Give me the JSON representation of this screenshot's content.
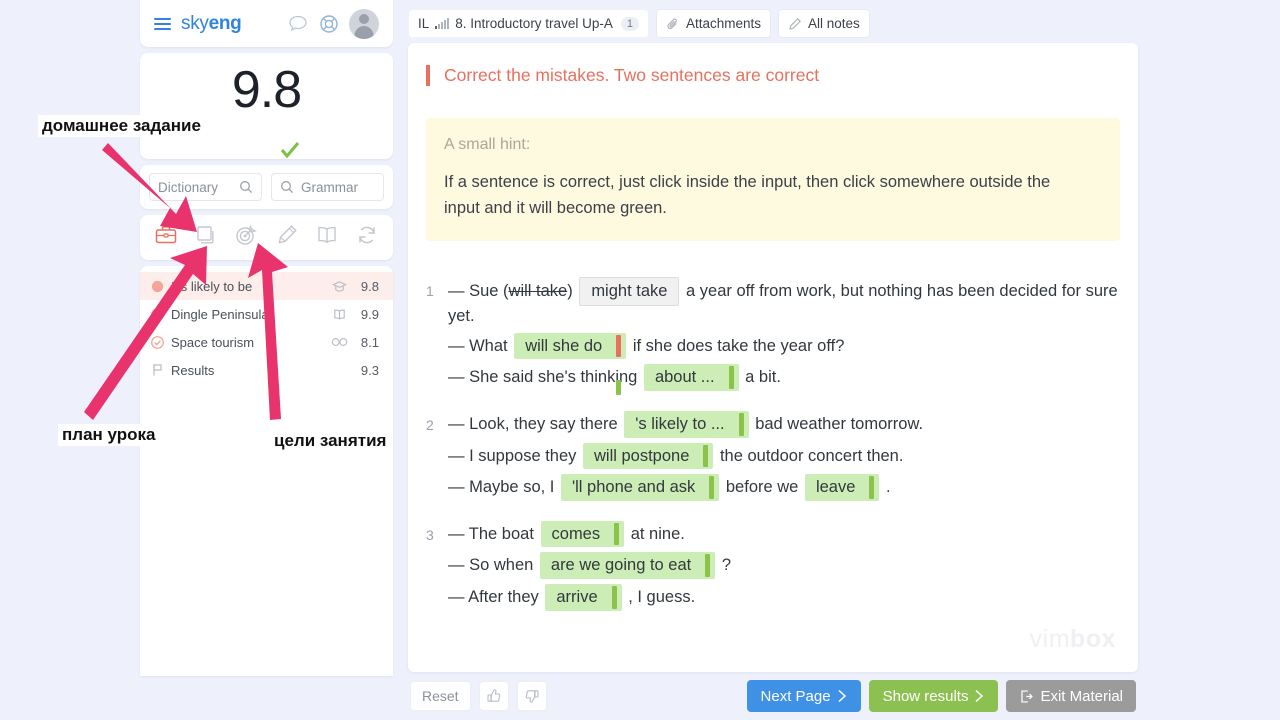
{
  "colors": {
    "page_bg": "#eef1fb",
    "brand_blue": "#2f84e0",
    "task_red": "#e8705f",
    "input_green": "#cdedb6",
    "accent_green": "#8bc34a",
    "next_blue": "#3e91e5",
    "results_green": "#8cc152",
    "exit_grey": "#9b9b9b",
    "annotation_pink": "#e8336d",
    "active_row": "#fdeeec",
    "hint_yellow": "#fdfae0"
  },
  "sidebar": {
    "logo": {
      "light": "sky",
      "bold": "eng"
    },
    "header_icons": [
      {
        "name": "chat-icon",
        "glyph": "chat-bubble"
      },
      {
        "name": "help-icon",
        "glyph": "lifebuoy"
      },
      {
        "name": "avatar",
        "glyph": "user-photo"
      }
    ],
    "score": "9.8",
    "search_dictionary": {
      "value": "",
      "placeholder": "Dictionary"
    },
    "search_grammar": {
      "value": "",
      "placeholder": "Grammar"
    },
    "tools": [
      {
        "name": "homework-icon",
        "label": "briefcase",
        "active": true
      },
      {
        "name": "cards-icon",
        "label": "copy",
        "active": false
      },
      {
        "name": "goals-icon",
        "label": "target",
        "active": false
      },
      {
        "name": "notes-icon",
        "label": "pencil",
        "active": false
      },
      {
        "name": "book-icon",
        "label": "book",
        "active": false
      },
      {
        "name": "refresh-icon",
        "label": "refresh",
        "active": false
      }
    ],
    "items": [
      {
        "label": "It's likely to be",
        "score": "9.8",
        "icon": "graduation-cap-icon",
        "status": "current",
        "active": true
      },
      {
        "label": "Dingle Peninsula",
        "score": "9.9",
        "icon": "open-book-icon",
        "status": "done",
        "active": false
      },
      {
        "label": "Space tourism",
        "score": "8.1",
        "icon": "glasses-icon",
        "status": "done",
        "active": false
      },
      {
        "label": "Results",
        "score": "9.3",
        "icon": "",
        "status": "flag",
        "active": false
      }
    ]
  },
  "topbar": {
    "lesson_prefix": "IL",
    "lesson_title": "8. Introductory travel Up-A",
    "lesson_badge": "1",
    "attachments_label": "Attachments",
    "all_notes_label": "All notes"
  },
  "main": {
    "task_title": "Correct the mistakes. Two sentences are correct",
    "hint_label": "A small hint:",
    "hint_text": "If a sentence is correct, just click inside the input, then click somewhere outside the input and it will become green.",
    "watermark": {
      "light": "vim",
      "bold": "box"
    },
    "exercises": [
      {
        "number": "1",
        "lines": [
          [
            {
              "t": "text",
              "v": "— Sue ("
            },
            {
              "t": "strike",
              "v": "will take"
            },
            {
              "t": "text",
              "v": ") "
            },
            {
              "t": "input-grey",
              "v": "might take"
            },
            {
              "t": "text",
              "v": " a year off from work, but nothing has been decided for sure yet."
            }
          ],
          [
            {
              "t": "text",
              "v": "— What "
            },
            {
              "t": "input-green-active",
              "v": "will she do"
            },
            {
              "t": "text",
              "v": " if she does take the year off?"
            }
          ],
          [
            {
              "t": "text",
              "v": "— She said she's thinking "
            },
            {
              "t": "input-green",
              "v": "about ..."
            },
            {
              "t": "text",
              "v": " a bit."
            }
          ]
        ]
      },
      {
        "number": "2",
        "lines": [
          [
            {
              "t": "text",
              "v": "— Look, they say there "
            },
            {
              "t": "input-green",
              "v": "'s likely to ..."
            },
            {
              "t": "text",
              "v": " bad weather tomorrow."
            }
          ],
          [
            {
              "t": "text",
              "v": "— I suppose they "
            },
            {
              "t": "input-green",
              "v": "will postpone"
            },
            {
              "t": "text",
              "v": " the outdoor concert then."
            }
          ],
          [
            {
              "t": "text",
              "v": "— Maybe so, I "
            },
            {
              "t": "input-green",
              "v": "'ll phone and ask"
            },
            {
              "t": "text",
              "v": " before we "
            },
            {
              "t": "input-green",
              "v": "leave"
            },
            {
              "t": "text",
              "v": " ."
            }
          ]
        ]
      },
      {
        "number": "3",
        "lines": [
          [
            {
              "t": "text",
              "v": "— The boat "
            },
            {
              "t": "input-green",
              "v": "comes"
            },
            {
              "t": "text",
              "v": " at nine."
            }
          ],
          [
            {
              "t": "text",
              "v": "— So when "
            },
            {
              "t": "input-green",
              "v": "are we going to eat"
            },
            {
              "t": "text",
              "v": " ?"
            }
          ],
          [
            {
              "t": "text",
              "v": "— After they "
            },
            {
              "t": "input-green",
              "v": "arrive"
            },
            {
              "t": "text",
              "v": " , I guess."
            }
          ]
        ]
      }
    ]
  },
  "footer": {
    "reset_label": "Reset",
    "thumbs_up": "thumbs-up-icon",
    "thumbs_down": "thumbs-down-icon",
    "next_label": "Next Page",
    "results_label": "Show results",
    "exit_label": "Exit Material"
  },
  "annotations": [
    {
      "name": "annotation-homework",
      "text": "домашнее задание"
    },
    {
      "name": "annotation-lesson-plan",
      "text": "план урока"
    },
    {
      "name": "annotation-lesson-goals",
      "text": "цели занятия"
    }
  ]
}
